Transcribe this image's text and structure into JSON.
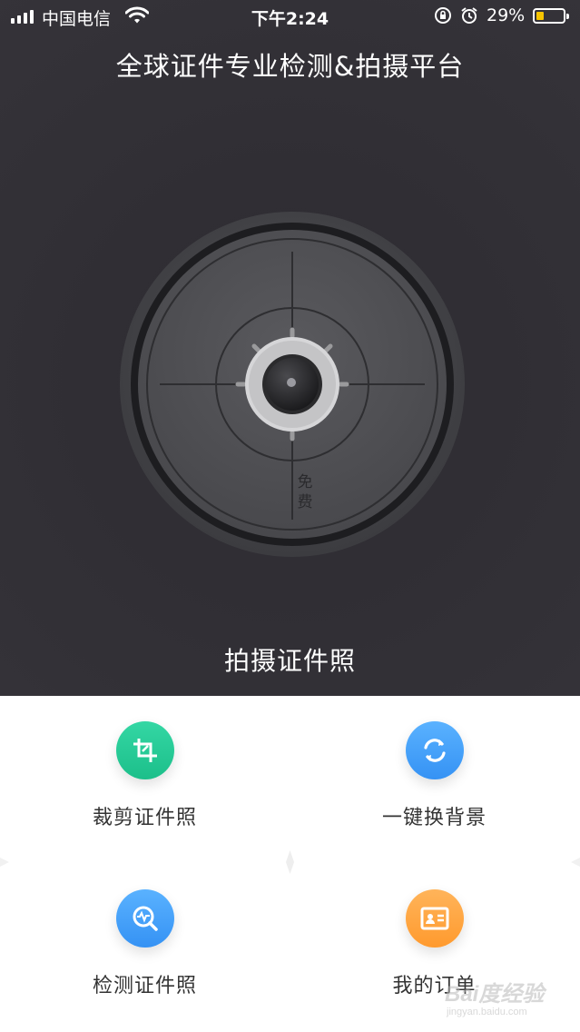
{
  "status_bar": {
    "carrier": "中国电信",
    "time": "下午2:24",
    "battery_percent": "29%",
    "battery_level": 0.29,
    "battery_fill_color": "#f5c400"
  },
  "header": {
    "title": "全球证件专业检测&拍摄平台"
  },
  "camera": {
    "badge_text": "免\n费",
    "shoot_label": "拍摄证件照"
  },
  "features": [
    {
      "label": "裁剪证件照",
      "icon": "crop-icon",
      "color_top": "#34d7a4",
      "color_bottom": "#1cbf8a"
    },
    {
      "label": "一键换背景",
      "icon": "refresh-icon",
      "color_top": "#5ab2ff",
      "color_bottom": "#3592f4"
    },
    {
      "label": "检测证件照",
      "icon": "scan-detect-icon",
      "color_top": "#5ab2ff",
      "color_bottom": "#3592f4"
    },
    {
      "label": "我的订单",
      "icon": "id-card-icon",
      "color_top": "#ffb45a",
      "color_bottom": "#ff9a2e"
    }
  ],
  "watermark": {
    "main": "Bai度经验",
    "sub": "jingyan.baidu.com"
  }
}
